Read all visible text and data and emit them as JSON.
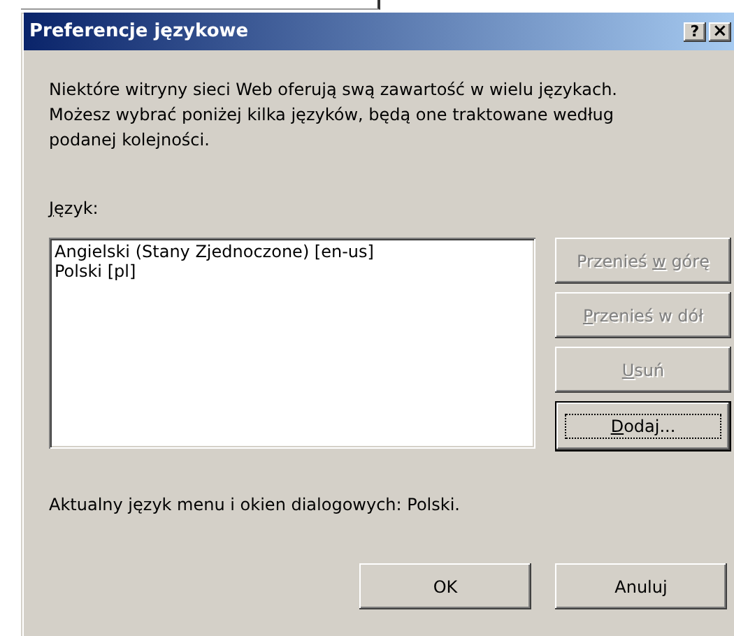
{
  "window": {
    "title": "Preferencje językowe",
    "title_buttons": [
      {
        "kind": "help",
        "label": "?"
      },
      {
        "kind": "close",
        "label": "×"
      }
    ]
  },
  "description": "Niektóre witryny sieci Web oferują swą zawartość w wielu językach. Możesz wybrać poniżej kilka języków, będą one traktowane według podanej kolejności.",
  "language_label": {
    "key": "J",
    "after": "ęzyk:"
  },
  "languages": [
    {
      "label": "Angielski (Stany Zjednoczone) [en-us]",
      "selected": false
    },
    {
      "label": "Polski [pl]",
      "selected": false
    }
  ],
  "side_buttons": [
    {
      "before": "Przenieś ",
      "key": "w",
      "after": " górę",
      "disabled": true,
      "focused": false
    },
    {
      "key": "P",
      "after": "rzenieś w dół",
      "disabled": true,
      "focused": false
    },
    {
      "key": "U",
      "after": "suń",
      "disabled": true,
      "focused": false
    },
    {
      "key": "D",
      "after": "odaj...",
      "disabled": false,
      "focused": true
    }
  ],
  "current_language": "Aktualny język menu i okien dialogowych: Polski.",
  "dialog_buttons": [
    {
      "before": "OK",
      "disabled": false,
      "focused": false
    },
    {
      "before": "Anuluj",
      "disabled": false,
      "focused": false
    }
  ]
}
